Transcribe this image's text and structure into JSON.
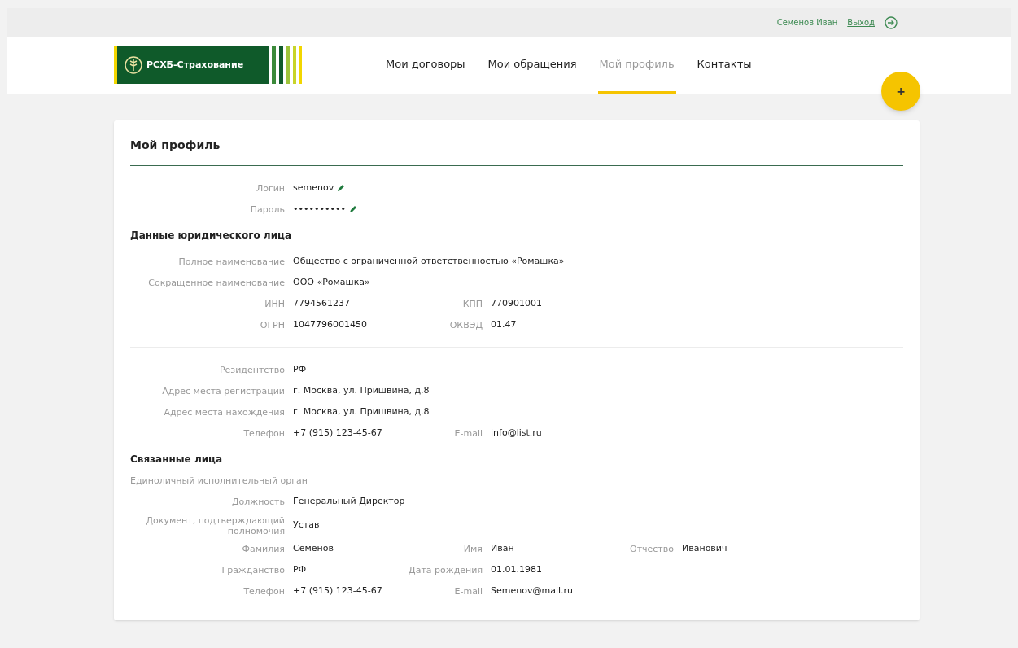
{
  "top_bar": {
    "user_name": "Семенов Иван",
    "logout_link": "Выход"
  },
  "header": {
    "logo_text": "РСХБ-Страхование",
    "fab": "+",
    "nav": [
      {
        "label": "Мои договоры",
        "selected": false
      },
      {
        "label": "Мои обращения",
        "selected": false
      },
      {
        "label": "Мой профиль",
        "selected": true
      },
      {
        "label": "Контакты",
        "selected": false
      }
    ]
  },
  "profile": {
    "title": "Мой профиль",
    "blocks": [
      {
        "kind": "rows",
        "rows": [
          {
            "fields": [
              {
                "label": "Логин",
                "value": "semenov",
                "editable": true
              }
            ]
          },
          {
            "fields": [
              {
                "label": "Пароль",
                "value": "••••••••••",
                "editable": true
              }
            ]
          }
        ]
      },
      {
        "kind": "heading",
        "text": "Данные юридического лица"
      },
      {
        "kind": "rows",
        "rows": [
          {
            "fields": [
              {
                "label": "Полное наименование",
                "value": "Общество с ограниченной ответственностью «Ромашка»"
              }
            ]
          },
          {
            "fields": [
              {
                "label": "Сокращенное наименование",
                "value": "ООО «Ромашка»"
              }
            ]
          },
          {
            "fields": [
              {
                "label": "ИНН",
                "value": "7794561237"
              },
              {
                "label": "КПП",
                "value": "770901001"
              }
            ]
          },
          {
            "fields": [
              {
                "label": "ОГРН",
                "value": "1047796001450"
              },
              {
                "label": "ОКВЭД",
                "value": "01.47"
              }
            ]
          }
        ]
      },
      {
        "kind": "divider"
      },
      {
        "kind": "rows",
        "rows": [
          {
            "fields": [
              {
                "label": "Резидентство",
                "value": "РФ"
              }
            ]
          },
          {
            "fields": [
              {
                "label": "Адрес места регистрации",
                "value": "г. Москва, ул. Пришвина, д.8"
              }
            ]
          },
          {
            "fields": [
              {
                "label": "Адрес места нахождения",
                "value": "г. Москва, ул. Пришвина, д.8"
              }
            ]
          },
          {
            "fields": [
              {
                "label": "Телефон",
                "value": "+7 (915) 123-45-67"
              },
              {
                "label": "E-mail",
                "value": "info@list.ru"
              }
            ]
          }
        ]
      },
      {
        "kind": "heading",
        "text": "Связанные лица"
      },
      {
        "kind": "subheading",
        "text": "Единоличный исполнительный орган"
      },
      {
        "kind": "rows",
        "rows": [
          {
            "fields": [
              {
                "label": "Должность",
                "value": "Генеральный Директор"
              }
            ]
          },
          {
            "fields": [
              {
                "label": "Документ, подтверждающий полномочия",
                "value": "Устав"
              }
            ]
          },
          {
            "fields": [
              {
                "label": "Фамилия",
                "value": "Семенов"
              },
              {
                "label": "Имя",
                "value": "Иван"
              },
              {
                "label": "Отчество",
                "value": "Иванович"
              }
            ]
          },
          {
            "fields": [
              {
                "label": "Гражданство",
                "value": "РФ"
              },
              {
                "label": "Дата рождения",
                "value": "01.01.1981"
              }
            ]
          },
          {
            "fields": [
              {
                "label": "Телефон",
                "value": "+7 (915) 123-45-67"
              },
              {
                "label": "E-mail",
                "value": "Semenov@mail.ru"
              }
            ]
          }
        ]
      }
    ]
  }
}
